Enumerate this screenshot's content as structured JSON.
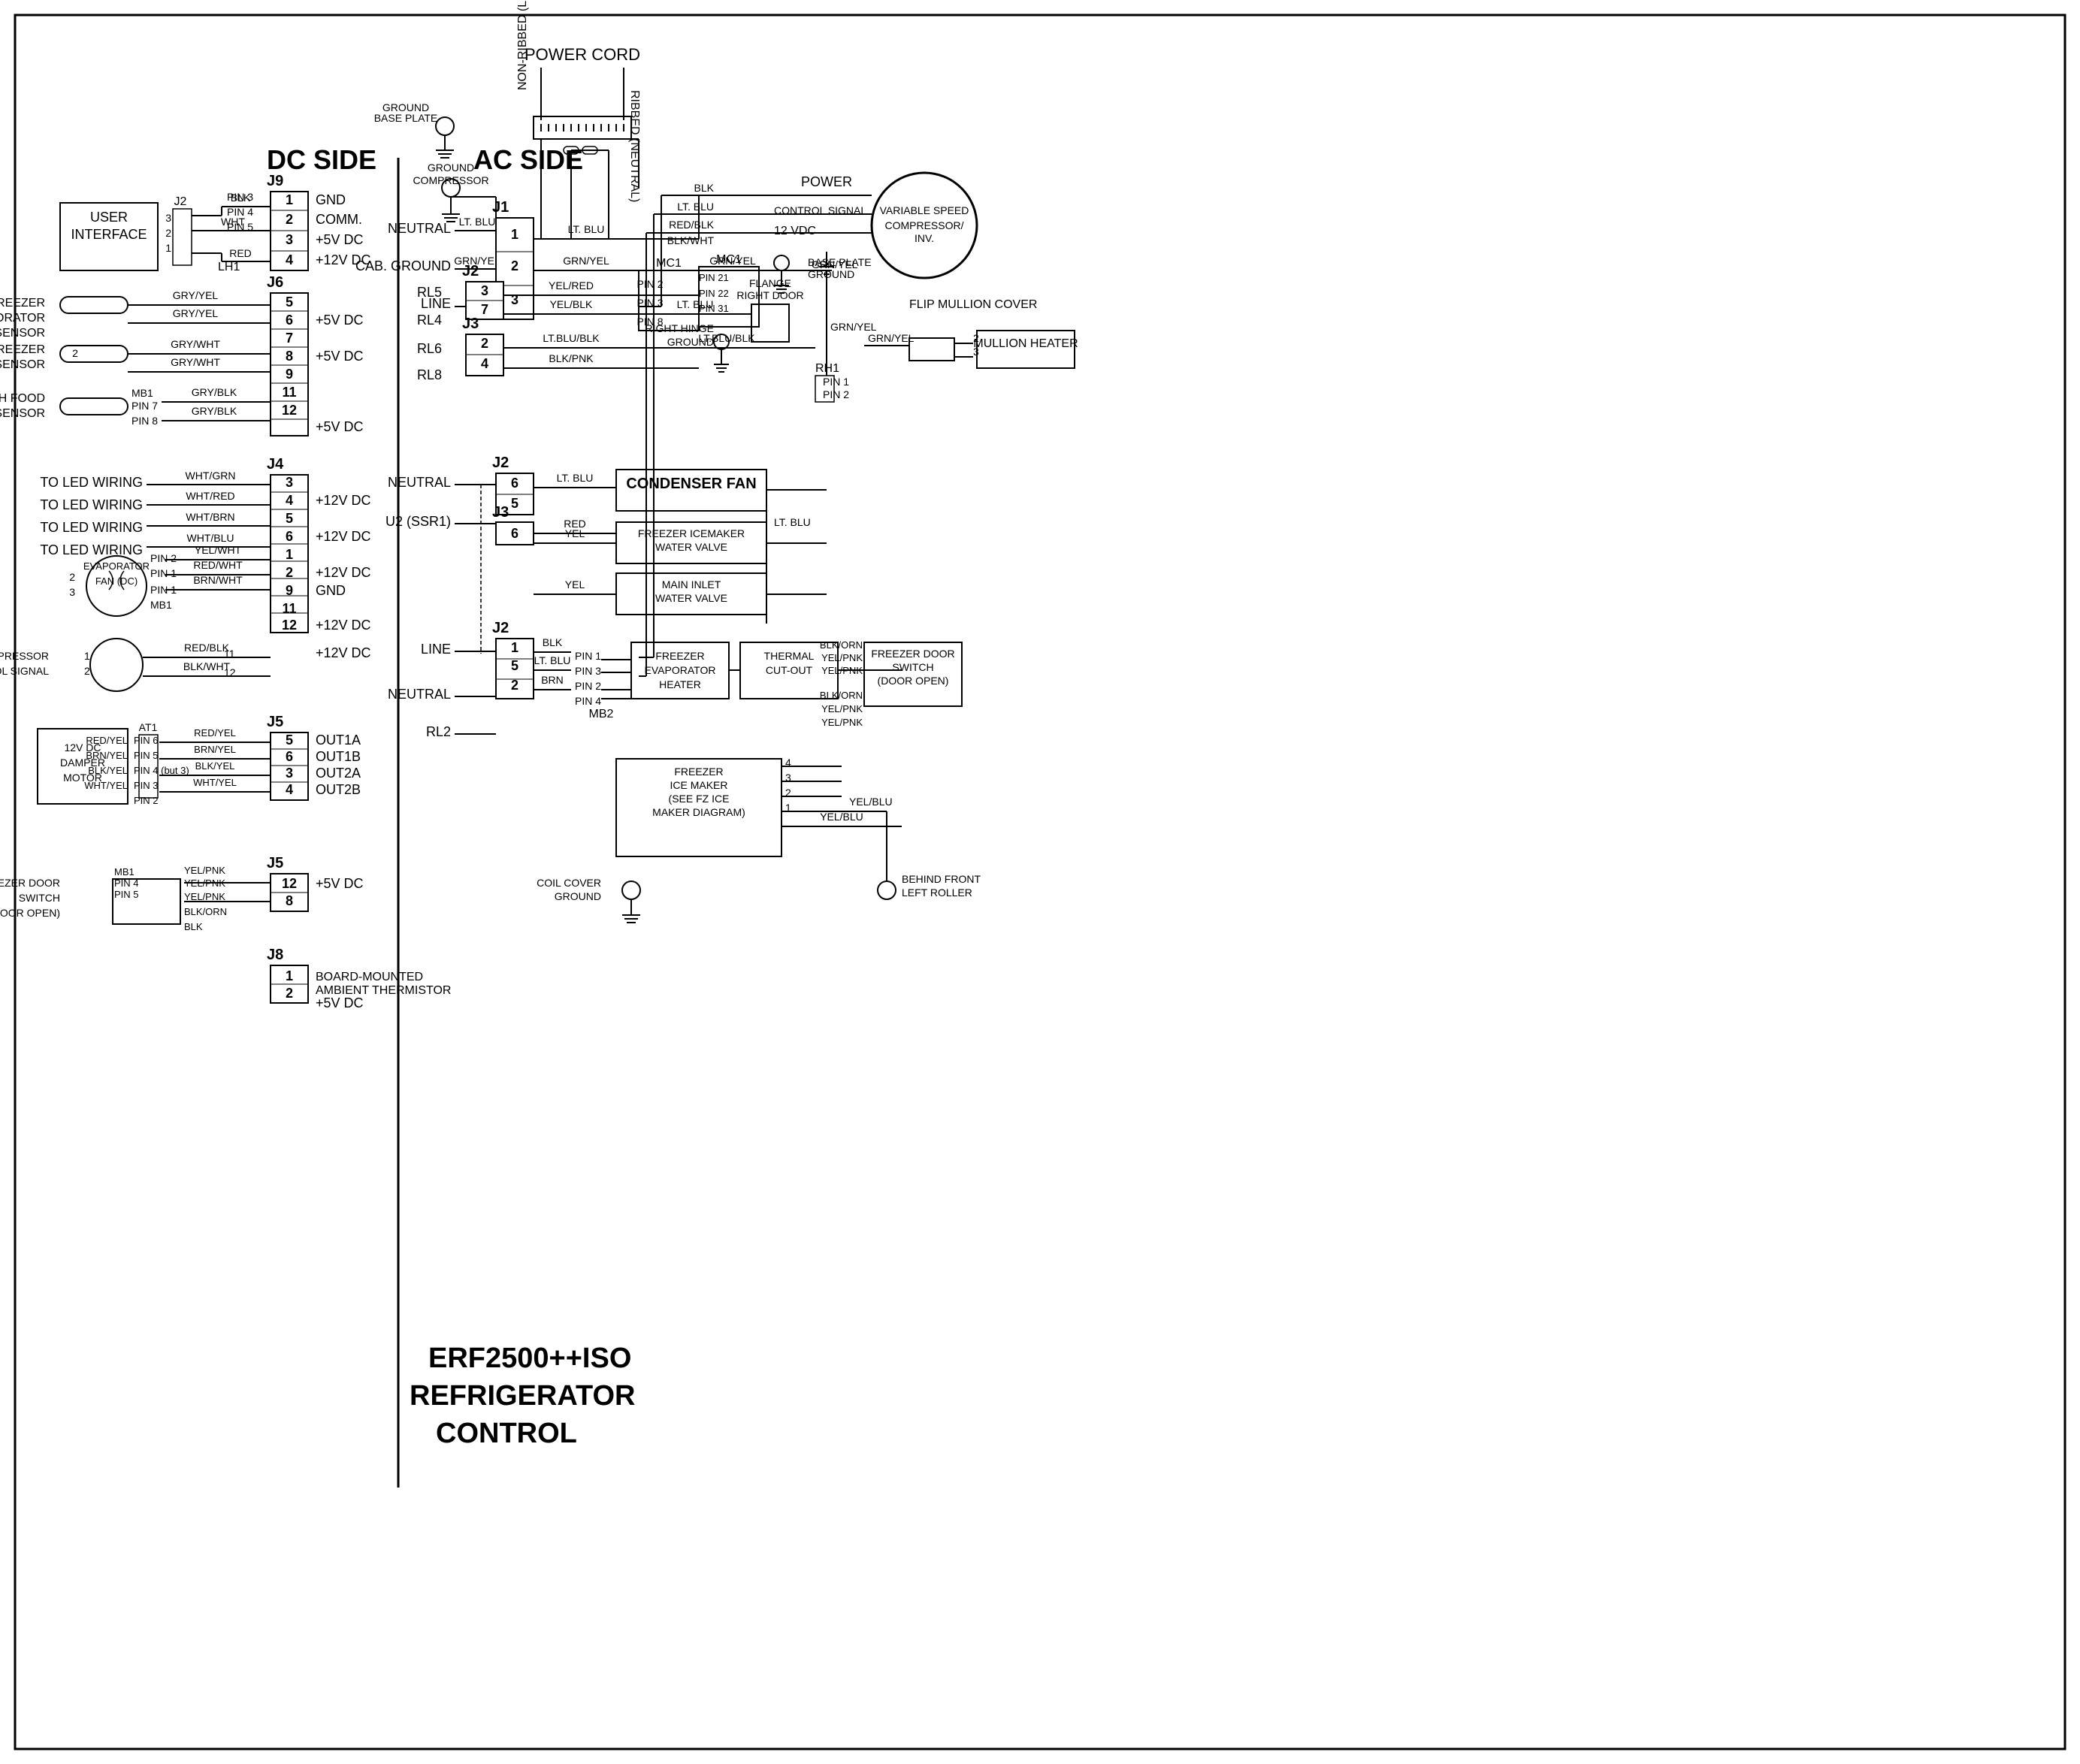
{
  "title": "ERF2500++ISO REFRIGERATOR CONTROL",
  "sections": {
    "dc_side": "DC SIDE",
    "ac_side": "AC SIDE"
  },
  "labels": {
    "user_interface": "USER INTERFACE",
    "condenser_fan": "CONDENSER FAN",
    "freezer_evaporator_sensor": "FREEZER EVAPORATOR SENSOR",
    "freezer_sensor": "FREEZER SENSOR",
    "fresh_food_sensor": "FRESH FOOD SENSOR",
    "to_led_wiring": "TO LED WIRING",
    "evaporator_fan_dc": "EVAPORATOR FAN (DC)",
    "compressor_control_signal": "COMPRESSOR CONTROL SIGNAL",
    "12v_dc_damper_motor": "12V DC DAMPER MOTOR",
    "freezer_door_switch": "FREEZER DOOR SWITCH (DOOR OPEN)",
    "board_mounted_ambient_thermistor": "BOARD-MOUNTED AMBIENT THERMISTOR",
    "power_cord": "POWER CORD",
    "variable_speed_compressor": "VARIABLE SPEED COMPRESSOR/ INV.",
    "flip_mullion_cover": "FLIP MULLION COVER",
    "mullion_heater": "MULLION HEATER",
    "freezer_icemaker_water_valve": "FREEZER ICEMAKER WATER VALVE",
    "main_inlet_water_valve": "MAIN INLET WATER VALVE",
    "freezer_evaporator_heater": "FREEZER EVAPORATOR HEATER",
    "thermal_cut_out": "THERMAL CUT-OUT",
    "freezer_door_switch_ac": "FREEZER DOOR SWITCH (DOOR OPEN)",
    "freezer_ice_maker": "FREEZER ICE MAKER (SEE FZ ICE MAKER DIAGRAM)",
    "coil_cover_ground": "COIL COVER GROUND",
    "behind_front_left_roller": "BEHIND FRONT LEFT ROLLER",
    "base_plate_ground": "BASE PLATE GROUND",
    "cab_ground": "CAB. GROUND",
    "right_door_flange": "RIGHT DOOR FLANGE",
    "right_hinge_ground": "RIGHT HINGE GROUND"
  }
}
